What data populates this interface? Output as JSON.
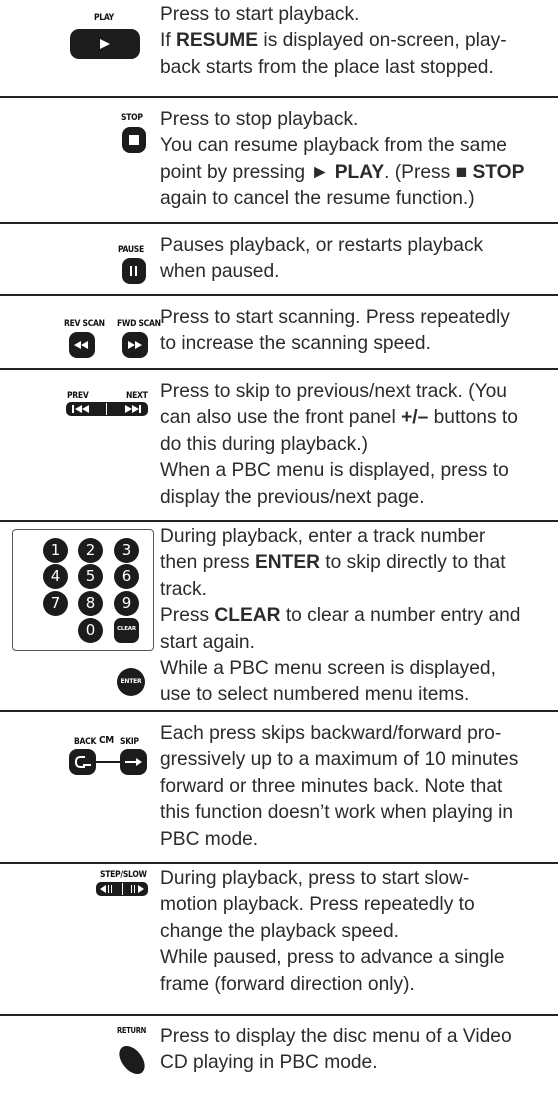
{
  "buttons": {
    "play": "PLAY",
    "stop": "STOP",
    "pause": "PAUSE",
    "rev_scan": "REV SCAN",
    "fwd_scan": "FWD SCAN",
    "prev": "PREV",
    "next": "NEXT",
    "clear": "CLEAR",
    "enter": "ENTER",
    "back": "BACK",
    "cm": "CM",
    "skip": "SKIP",
    "step_slow": "STEP/SLOW",
    "return": "RETURN"
  },
  "keypad": [
    "1",
    "2",
    "3",
    "4",
    "5",
    "6",
    "7",
    "8",
    "9",
    "0"
  ],
  "rows": {
    "play": [
      "Press to start playback.",
      "If ",
      "RESUME",
      " is displayed on-screen, play-",
      "back starts from the place last stopped."
    ],
    "stop": [
      "Press to stop playback.",
      "You can resume playback from the same",
      "point by pressing ",
      "► PLAY",
      ". (Press ",
      "■ STOP",
      "again to cancel the resume function.)"
    ],
    "pause": [
      "Pauses playback, or restarts playback",
      "when paused."
    ],
    "scan": [
      "Press to start scanning. Press repeatedly",
      "to increase the scanning speed."
    ],
    "prevnext": [
      "Press to skip to previous/next track. (You",
      "can also use the front panel ",
      "+/–",
      " buttons to",
      "do this during playback.)",
      "When a PBC menu is displayed, press to",
      "display the previous/next page."
    ],
    "numeric": [
      "During playback, enter a track number",
      "then press ",
      "ENTER",
      " to skip directly to that",
      "track.",
      "Press ",
      "CLEAR",
      " to clear a number entry and",
      "start again.",
      "While a PBC menu screen is displayed,",
      "use to select numbered menu items."
    ],
    "skip": [
      "Each press skips backward/forward pro-",
      "gressively up to a maximum of 10 minutes",
      "forward or three minutes back. Note that",
      "this function doesn’t work when playing in",
      "PBC mode."
    ],
    "step": [
      "During playback, press to start slow-",
      "motion playback. Press repeatedly to",
      "change the playback speed.",
      "While paused, press to advance a single",
      "frame (forward direction only)."
    ],
    "return": [
      "Press to display the disc menu of a Video",
      "CD playing in PBC mode."
    ]
  }
}
